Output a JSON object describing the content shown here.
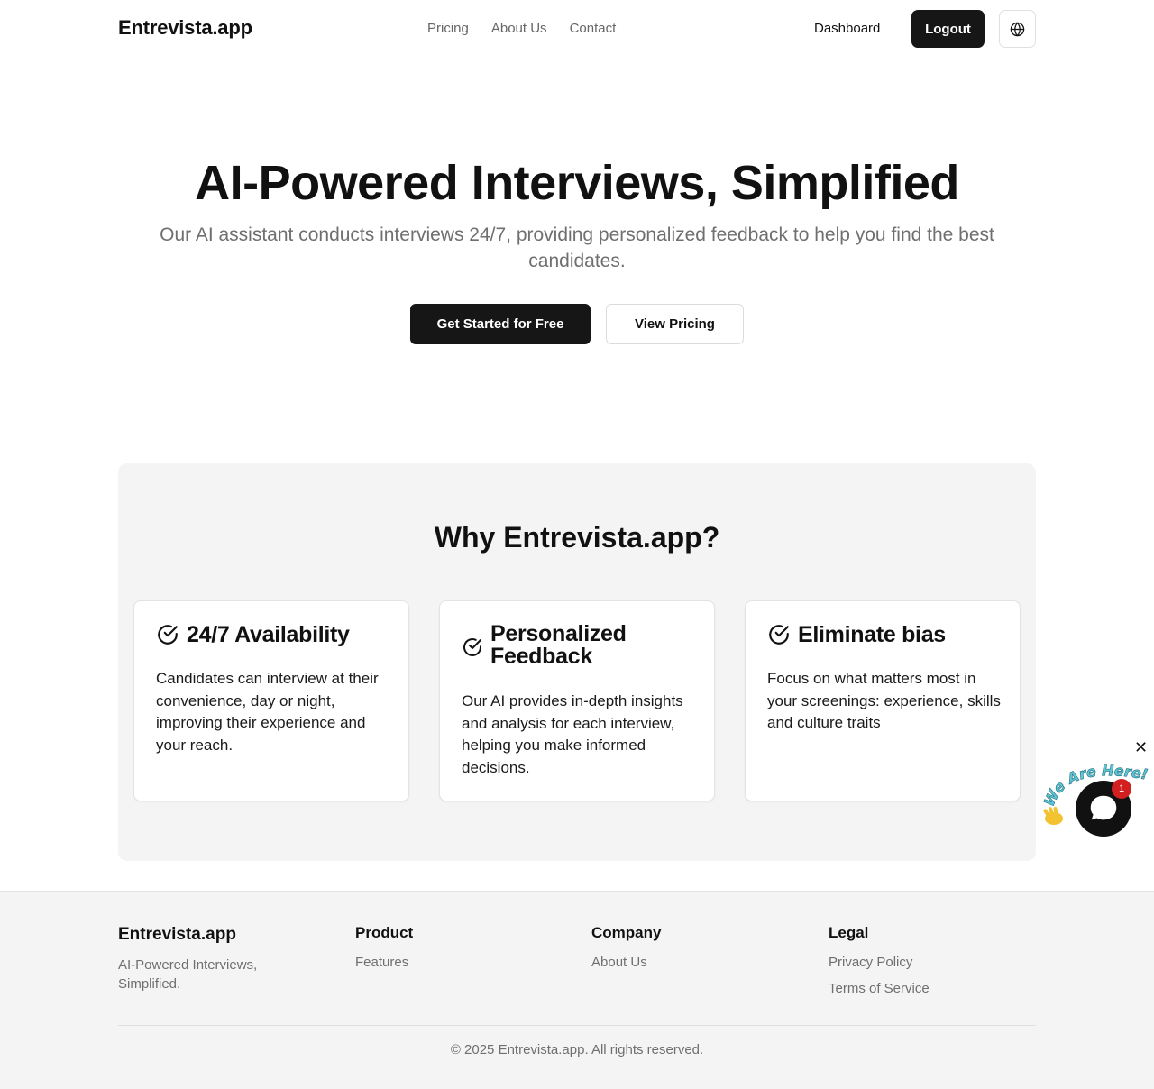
{
  "header": {
    "brand": "Entrevista.app",
    "nav": [
      "Pricing",
      "About Us",
      "Contact"
    ],
    "dashboard_label": "Dashboard",
    "logout_label": "Logout",
    "language_icon": "globe-icon"
  },
  "hero": {
    "title": "AI-Powered Interviews, Simplified",
    "subtitle": "Our AI assistant conducts interviews 24/7, providing personalized feedback to help you find the best candidates.",
    "primary_cta": "Get Started for Free",
    "secondary_cta": "View Pricing"
  },
  "why": {
    "title": "Why Entrevista.app?",
    "cards": [
      {
        "icon": "check-circle-icon",
        "title": "24/7 Availability",
        "text": "Candidates can interview at their convenience, day or night, improving their experience and your reach."
      },
      {
        "icon": "check-circle-icon",
        "title": "Personalized Feedback",
        "text": "Our AI provides in-depth insights and analysis for each interview, helping you make informed decisions."
      },
      {
        "icon": "check-circle-icon",
        "title": "Eliminate bias",
        "text": "Focus on what matters most in your screenings: experience, skills and culture traits"
      }
    ]
  },
  "footer": {
    "brand": "Entrevista.app",
    "tagline": "AI-Powered Interviews, Simplified.",
    "columns": [
      {
        "heading": "Product",
        "links": [
          "Features"
        ]
      },
      {
        "heading": "Company",
        "links": [
          "About Us"
        ]
      },
      {
        "heading": "Legal",
        "links": [
          "Privacy Policy",
          "Terms of Service"
        ]
      }
    ],
    "copyright": "© 2025 Entrevista.app. All rights reserved."
  },
  "chat_widget": {
    "banner_text": "We Are Here!",
    "badge_count": "1",
    "close_symbol": "✕",
    "colors": {
      "banner": "#5ec6d6",
      "badge": "#d21f1f",
      "hand": "#f2c230"
    }
  }
}
